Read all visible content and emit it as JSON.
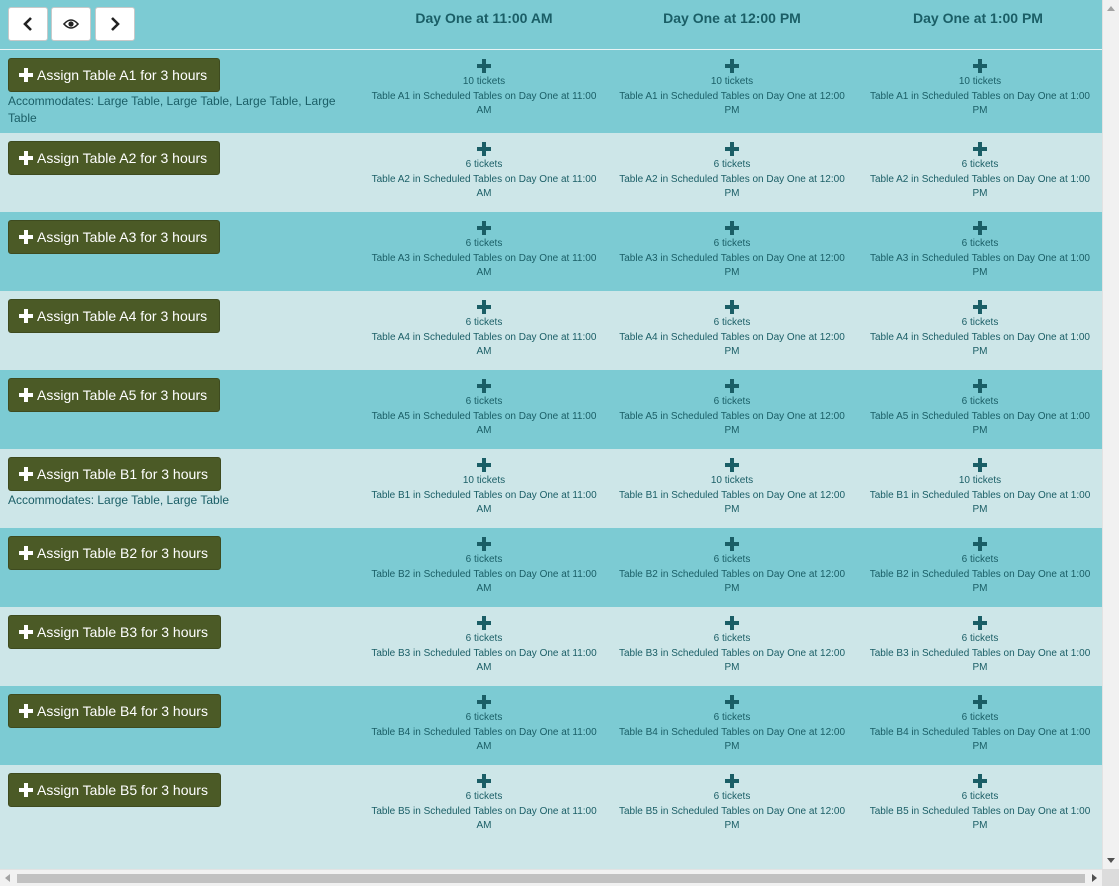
{
  "toolbar": {
    "prev_icon": "chevron-left-icon",
    "view_icon": "eye-icon",
    "next_icon": "chevron-right-icon"
  },
  "columns": [
    "Day One at 11:00 AM",
    "Day One at 12:00 PM",
    "Day One at 1:00 PM"
  ],
  "colors": {
    "header_bg": "#7ccbd3",
    "row_dark": "#7ccbd3",
    "row_light": "#cde6e8",
    "button_bg": "#4b5a26",
    "text": "#1a5e66"
  },
  "rows": [
    {
      "button": "Assign Table A1 for 3 hours",
      "accommodates": "Accommodates: Large Table, Large Table, Large Table, Large Table",
      "cells": [
        {
          "tickets": "10 tickets",
          "desc": "Table A1 in Scheduled Tables on Day One at 11:00 AM"
        },
        {
          "tickets": "10 tickets",
          "desc": "Table A1 in Scheduled Tables on Day One at 12:00 PM"
        },
        {
          "tickets": "10 tickets",
          "desc": "Table A1 in Scheduled Tables on Day One at 1:00 PM"
        }
      ]
    },
    {
      "button": "Assign Table A2 for 3 hours",
      "accommodates": "",
      "cells": [
        {
          "tickets": "6 tickets",
          "desc": "Table A2 in Scheduled Tables on Day One at 11:00 AM"
        },
        {
          "tickets": "6 tickets",
          "desc": "Table A2 in Scheduled Tables on Day One at 12:00 PM"
        },
        {
          "tickets": "6 tickets",
          "desc": "Table A2 in Scheduled Tables on Day One at 1:00 PM"
        }
      ]
    },
    {
      "button": "Assign Table A3 for 3 hours",
      "accommodates": "",
      "cells": [
        {
          "tickets": "6 tickets",
          "desc": "Table A3 in Scheduled Tables on Day One at 11:00 AM"
        },
        {
          "tickets": "6 tickets",
          "desc": "Table A3 in Scheduled Tables on Day One at 12:00 PM"
        },
        {
          "tickets": "6 tickets",
          "desc": "Table A3 in Scheduled Tables on Day One at 1:00 PM"
        }
      ]
    },
    {
      "button": "Assign Table A4 for 3 hours",
      "accommodates": "",
      "cells": [
        {
          "tickets": "6 tickets",
          "desc": "Table A4 in Scheduled Tables on Day One at 11:00 AM"
        },
        {
          "tickets": "6 tickets",
          "desc": "Table A4 in Scheduled Tables on Day One at 12:00 PM"
        },
        {
          "tickets": "6 tickets",
          "desc": "Table A4 in Scheduled Tables on Day One at 1:00 PM"
        }
      ]
    },
    {
      "button": "Assign Table A5 for 3 hours",
      "accommodates": "",
      "cells": [
        {
          "tickets": "6 tickets",
          "desc": "Table A5 in Scheduled Tables on Day One at 11:00 AM"
        },
        {
          "tickets": "6 tickets",
          "desc": "Table A5 in Scheduled Tables on Day One at 12:00 PM"
        },
        {
          "tickets": "6 tickets",
          "desc": "Table A5 in Scheduled Tables on Day One at 1:00 PM"
        }
      ]
    },
    {
      "button": "Assign Table B1 for 3 hours",
      "accommodates": "Accommodates: Large Table, Large Table",
      "cells": [
        {
          "tickets": "10 tickets",
          "desc": "Table B1 in Scheduled Tables on Day One at 11:00 AM"
        },
        {
          "tickets": "10 tickets",
          "desc": "Table B1 in Scheduled Tables on Day One at 12:00 PM"
        },
        {
          "tickets": "10 tickets",
          "desc": "Table B1 in Scheduled Tables on Day One at 1:00 PM"
        }
      ]
    },
    {
      "button": "Assign Table B2 for 3 hours",
      "accommodates": "",
      "cells": [
        {
          "tickets": "6 tickets",
          "desc": "Table B2 in Scheduled Tables on Day One at 11:00 AM"
        },
        {
          "tickets": "6 tickets",
          "desc": "Table B2 in Scheduled Tables on Day One at 12:00 PM"
        },
        {
          "tickets": "6 tickets",
          "desc": "Table B2 in Scheduled Tables on Day One at 1:00 PM"
        }
      ]
    },
    {
      "button": "Assign Table B3 for 3 hours",
      "accommodates": "",
      "cells": [
        {
          "tickets": "6 tickets",
          "desc": "Table B3 in Scheduled Tables on Day One at 11:00 AM"
        },
        {
          "tickets": "6 tickets",
          "desc": "Table B3 in Scheduled Tables on Day One at 12:00 PM"
        },
        {
          "tickets": "6 tickets",
          "desc": "Table B3 in Scheduled Tables on Day One at 1:00 PM"
        }
      ]
    },
    {
      "button": "Assign Table B4 for 3 hours",
      "accommodates": "",
      "cells": [
        {
          "tickets": "6 tickets",
          "desc": "Table B4 in Scheduled Tables on Day One at 11:00 AM"
        },
        {
          "tickets": "6 tickets",
          "desc": "Table B4 in Scheduled Tables on Day One at 12:00 PM"
        },
        {
          "tickets": "6 tickets",
          "desc": "Table B4 in Scheduled Tables on Day One at 1:00 PM"
        }
      ]
    },
    {
      "button": "Assign Table B5 for 3 hours",
      "accommodates": "",
      "cells": [
        {
          "tickets": "6 tickets",
          "desc": "Table B5 in Scheduled Tables on Day One at 11:00 AM"
        },
        {
          "tickets": "6 tickets",
          "desc": "Table B5 in Scheduled Tables on Day One at 12:00 PM"
        },
        {
          "tickets": "6 tickets",
          "desc": "Table B5 in Scheduled Tables on Day One at 1:00 PM"
        }
      ]
    }
  ]
}
